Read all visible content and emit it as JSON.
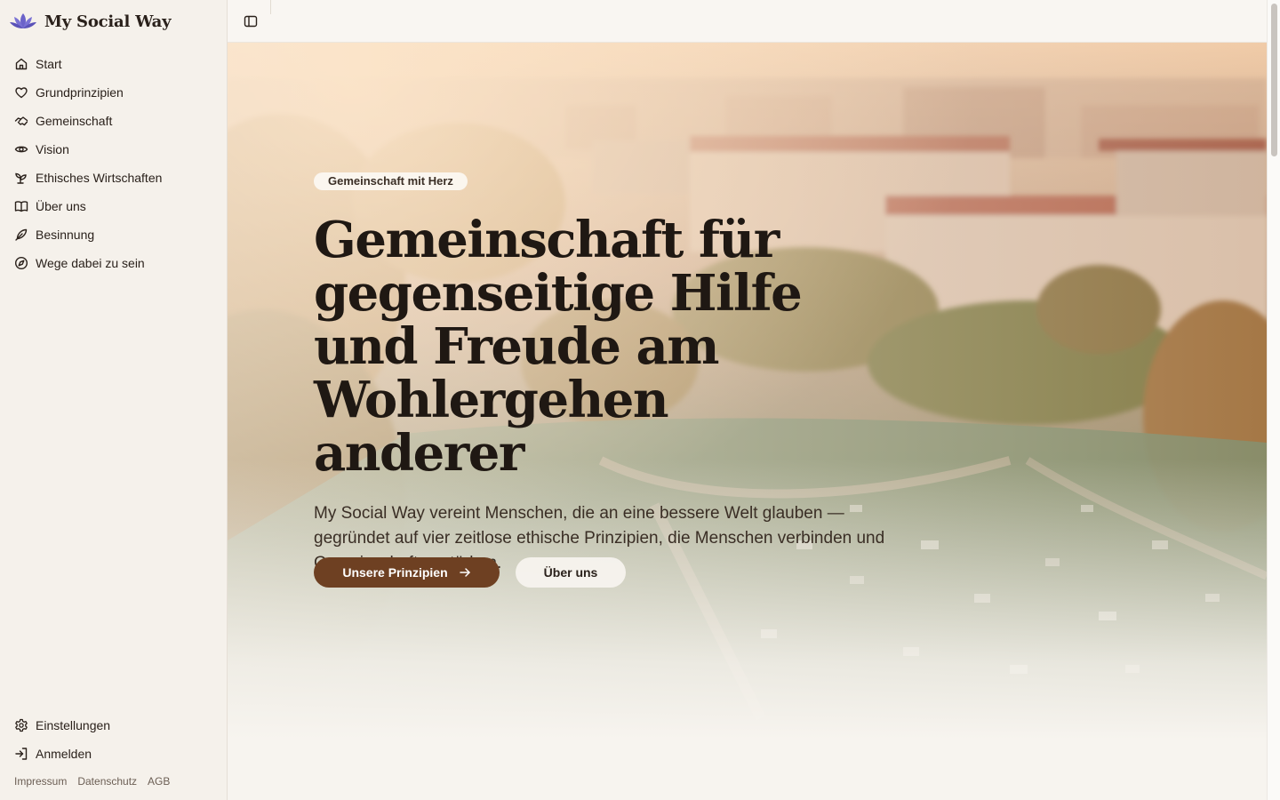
{
  "brand": {
    "name": "My Social Way",
    "logo_icon": "lotus-icon",
    "accent": "#6b63c9"
  },
  "sidebar": {
    "items": [
      {
        "label": "Start",
        "icon": "home-icon"
      },
      {
        "label": "Grundprinzipien",
        "icon": "heart-icon"
      },
      {
        "label": "Gemeinschaft",
        "icon": "handshake-icon"
      },
      {
        "label": "Vision",
        "icon": "eye-icon"
      },
      {
        "label": "Ethisches Wirtschaften",
        "icon": "sprout-icon"
      },
      {
        "label": "Über uns",
        "icon": "book-icon"
      },
      {
        "label": "Besinnung",
        "icon": "feather-icon"
      },
      {
        "label": "Wege dabei zu sein",
        "icon": "compass-icon"
      }
    ],
    "bottom_items": [
      {
        "label": "Einstellungen",
        "icon": "gear-icon"
      },
      {
        "label": "Anmelden",
        "icon": "login-icon"
      }
    ],
    "legal": [
      "Impressum",
      "Datenschutz",
      "AGB"
    ]
  },
  "topbar": {
    "toggle_icon": "sidebar-toggle-icon"
  },
  "hero": {
    "badge": "Gemeinschaft mit Herz",
    "headline": "Gemeinschaft für gegenseitige Hilfe und Freude am Wohlergehen anderer",
    "lead": "My Social Way vereint Menschen, die an eine bessere Welt glauben — gegründet auf vier zeitlose ethische Prinzipien, die Menschen verbinden und Gemeinschaften stärken.",
    "primary_cta": "Unsere Prinzipien",
    "secondary_cta": "Über uns",
    "background": "aerial-city-park-photo"
  },
  "colors": {
    "primary": "#6e4022",
    "background": "#f7f4ef",
    "sidebar": "#f5f1eb",
    "text": "#2a211b"
  }
}
